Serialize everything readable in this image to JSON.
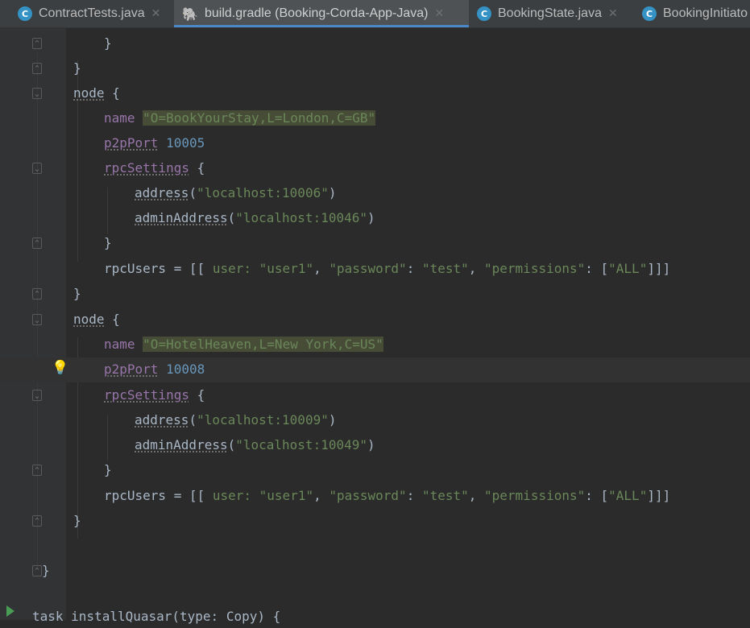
{
  "tabs": [
    {
      "label": "ContractTests.java",
      "icon": "java-class-icon",
      "active": false
    },
    {
      "label": "build.gradle (Booking-Corda-App-Java)",
      "icon": "gradle-icon",
      "active": true
    },
    {
      "label": "BookingState.java",
      "icon": "java-class-icon",
      "active": false
    },
    {
      "label": "BookingInitiato",
      "icon": "java-class-icon",
      "active": false
    }
  ],
  "code": {
    "l1": "}",
    "l2": "}",
    "node_kw": "node",
    "brace_open": " {",
    "brace_close": "}",
    "name_kw": "name",
    "node1_name": "\"O=BookYourStay,L=London,C=GB\"",
    "p2p_kw": "p2pPort",
    "node1_p2p": "10005",
    "rpc_kw": "rpcSettings",
    "address_kw": "address",
    "node1_address": "\"localhost:10006\"",
    "admin_kw": "adminAddress",
    "node1_admin": "\"localhost:10046\"",
    "rpcusers_kw": "rpcUsers = [[ ",
    "user_label": "user: ",
    "user_val": "\"user1\"",
    "password_key": "\"password\"",
    "password_val": "\"test\"",
    "perm_key": "\"permissions\"",
    "perm_val": "\"ALL\"",
    "node2_name": "\"O=HotelHeaven,L=New York,C=US\"",
    "node2_p2p": "10008",
    "node2_address": "\"localhost:10009\"",
    "node2_admin": "\"localhost:10049\"",
    "final_brace": "}",
    "task_line": "task installQuasar(type: Copy) {"
  },
  "colors": {
    "keyword": "#cc7832",
    "string": "#6a8759",
    "number": "#6897bb",
    "property": "#9876aa",
    "accent": "#4a88c7"
  }
}
